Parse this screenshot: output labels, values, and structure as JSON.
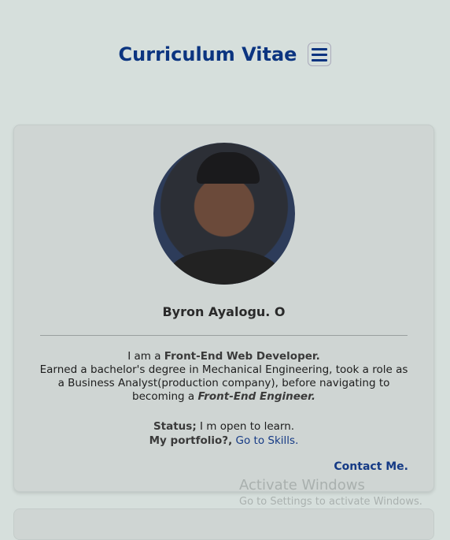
{
  "header": {
    "title": "Curriculum Vitae",
    "menu_icon": "hamburger-icon"
  },
  "profile": {
    "name": "Byron Ayalogu. O",
    "intro_prefix": "I am a ",
    "intro_role": "Front-End Web Developer.",
    "bio_text": "Earned a bachelor's degree in Mechanical Engineering, took a role as a Business Analyst(production company), before navigating to becoming a ",
    "bio_role": "Front-End Engineer.",
    "status_label": "Status;",
    "status_text": " I m open to learn.",
    "portfolio_label": "My portfolio?,",
    "portfolio_link": "Go to Skills.",
    "contact_link": "Contact Me."
  },
  "watermark": {
    "title": "Activate Windows",
    "subtitle": "Go to Settings to activate Windows."
  }
}
